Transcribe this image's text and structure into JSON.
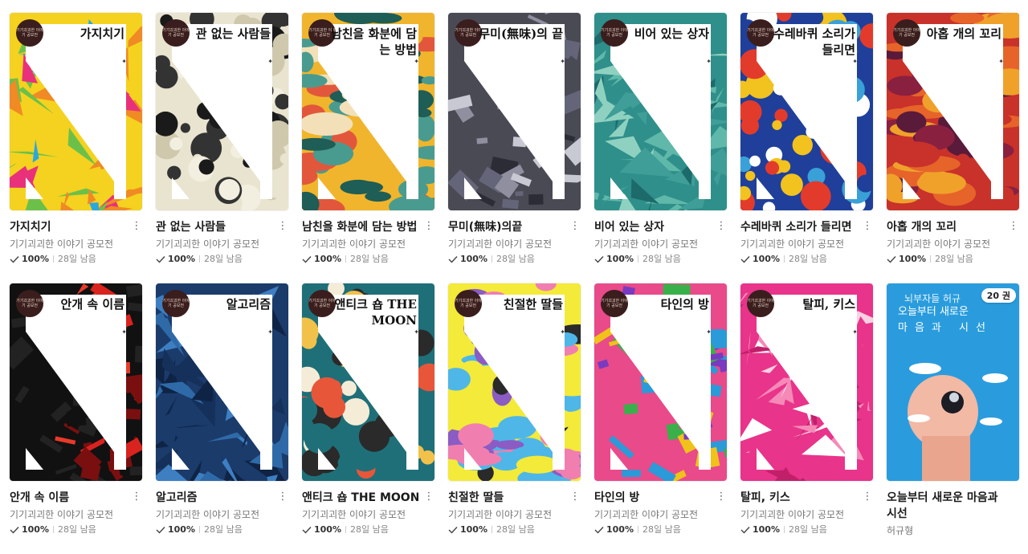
{
  "books": [
    {
      "cover_title": "가지치기",
      "title": "가지치기",
      "author": "기기괴괴한 이야기 공모전",
      "progress_label": "100%",
      "remain": "28일 남음",
      "progress": 1.0,
      "colors": [
        "#f4d21f",
        "#e8317a",
        "#2aa7e0",
        "#6cc04a",
        "#f08a24"
      ]
    },
    {
      "cover_title": "관 없는 사람들",
      "title": "관 없는 사람들",
      "author": "기기괴괴한 이야기 공모전",
      "progress_label": "100%",
      "remain": "28일 남음",
      "progress": 1.0,
      "colors": [
        "#e9e4cf",
        "#1a1a1a",
        "#cfc8ad",
        "#333333",
        "#f2efe0"
      ]
    },
    {
      "cover_title": "남친을 화분에 담는 방법",
      "title": "남친을 화분에 담는 방법",
      "author": "기기괴괴한 이야기 공모전",
      "progress_label": "100%",
      "remain": "28일 남음",
      "progress": 1.0,
      "colors": [
        "#f0b52c",
        "#1f5d57",
        "#e2573b",
        "#f3e0b8",
        "#4a9b8f"
      ]
    },
    {
      "cover_title": "무미(無味)의 끝",
      "title": "무미(無味)의끝",
      "author": "기기괴괴한 이야기 공모전",
      "progress_label": "100%",
      "remain": "28일 남음",
      "progress": 1.0,
      "colors": [
        "#4a4a55",
        "#8f8fa0",
        "#2c2c36",
        "#c9c9d4",
        "#65657a"
      ]
    },
    {
      "cover_title": "비어 있는 상자",
      "title": "비어 있는 상자",
      "author": "기기괴괴한 이야기 공모전",
      "progress_label": "100%",
      "remain": "28일 남음",
      "progress": 1.0,
      "colors": [
        "#2f8f8a",
        "#5fb8a9",
        "#1d6a6b",
        "#8fd1c0",
        "#3f9e97"
      ]
    },
    {
      "cover_title": "수레바퀴 소리가 들리면",
      "title": "수레바퀴 소리가 들리면",
      "author": "기기괴괴한 이야기 공모전",
      "progress_label": "100%",
      "remain": "28일 남음",
      "progress": 1.0,
      "colors": [
        "#1f3f9a",
        "#f2c21f",
        "#e23b2c",
        "#ffffff",
        "#3aa0d8"
      ]
    },
    {
      "cover_title": "아홉 개의 꼬리",
      "title": "아홉 개의 꼬리",
      "author": "기기괴괴한 이야기 공모전",
      "progress_label": "100%",
      "remain": "28일 남음",
      "progress": 1.0,
      "colors": [
        "#c8322a",
        "#f0a12a",
        "#5a1a3a",
        "#e6642a",
        "#8a2040"
      ]
    },
    {
      "cover_title": "안개 속 이름",
      "title": "안개 속 이름",
      "author": "기기괴괴한 이야기 공모전",
      "progress_label": "100%",
      "remain": "28일 남음",
      "progress": 1.0,
      "colors": [
        "#111111",
        "#d8231f",
        "#7a0f10",
        "#222222",
        "#e83a2a"
      ]
    },
    {
      "cover_title": "알고리즘",
      "title": "알고리즘",
      "author": "기기괴괴한 이야기 공모전",
      "progress_label": "100%",
      "remain": "28일 남음",
      "progress": 1.0,
      "colors": [
        "#1b3b6b",
        "#2f6aa8",
        "#0f2445",
        "#3e7fc2",
        "#15305a"
      ]
    },
    {
      "cover_title": "앤티크 숍 THE MOON",
      "title": "앤티크 숍 THE MOON",
      "author": "기기괴괴한 이야기 공모전",
      "progress_label": "100%",
      "remain": "28일 남음",
      "progress": 1.0,
      "colors": [
        "#1f6f78",
        "#e8563a",
        "#f2c14a",
        "#2a2a2a",
        "#f5ecd7"
      ]
    },
    {
      "cover_title": "친절한 딸들",
      "title": "친절한 딸들",
      "author": "기기괴괴한 이야기 공모전",
      "progress_label": "100%",
      "remain": "28일 남음",
      "progress": 1.0,
      "colors": [
        "#f3ea3a",
        "#4fb6e8",
        "#8a5cc4",
        "#f07fb0",
        "#2a2a2a"
      ]
    },
    {
      "cover_title": "타인의 방",
      "title": "타인의 방",
      "author": "기기괴괴한 이야기 공모전",
      "progress_label": "100%",
      "remain": "28일 남음",
      "progress": 1.0,
      "colors": [
        "#e84a8a",
        "#3ab04a",
        "#f0c21a",
        "#7a3ac0",
        "#2a9ad8"
      ]
    },
    {
      "cover_title": "탈피, 키스",
      "title": "탈피, 키스",
      "author": "기기괴괴한 이야기 공모전",
      "progress_label": "100%",
      "remain": "28일 남음",
      "progress": 1.0,
      "colors": [
        "#e8348a",
        "#ffffff",
        "#f58ab8",
        "#c0206a",
        "#fbd0e2"
      ]
    }
  ],
  "special_book": {
    "cover_subtitle": "뇌부자들 허규",
    "cover_title_line1": "오늘부터 새로운",
    "cover_title_line2": "마음과 시선",
    "badge": "20 권",
    "title": "오늘부터 새로운 마음과 시선",
    "author": "허규형",
    "color": "#2a9cdd"
  },
  "seal_text": "기기괴괴한 이야기 공모전",
  "more_icon": "⋮"
}
